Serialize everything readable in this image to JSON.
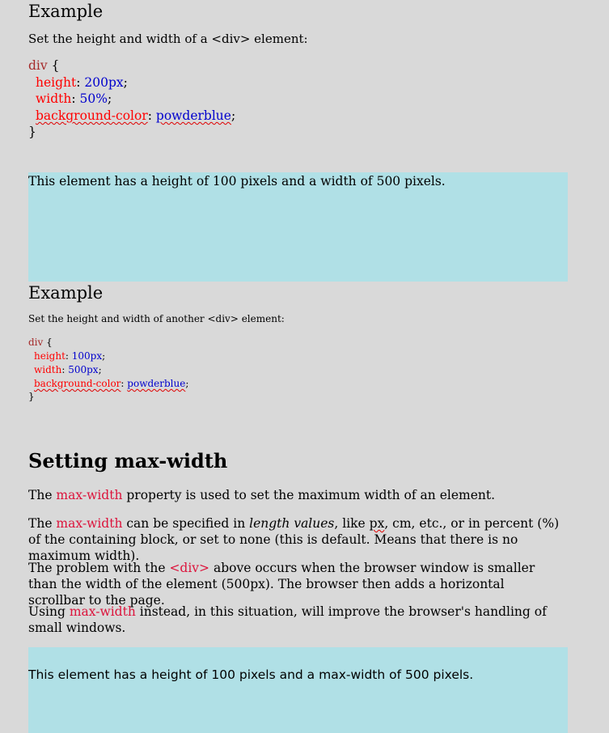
{
  "example1": {
    "heading": "Example",
    "intro": "Set the height and width of a <div> element:",
    "code": {
      "selector": "div",
      "open": " {",
      "lines": [
        {
          "prop": "height",
          "value": "200px"
        },
        {
          "prop": "width",
          "value": "50%"
        },
        {
          "prop": "background-color",
          "value": "powderblue"
        }
      ],
      "close": "}"
    }
  },
  "box1_text": "This element has a height of 100 pixels and a width of 500 pixels.",
  "example2": {
    "heading": "Example",
    "intro": "Set the height and width of another <div> element:",
    "code": {
      "selector": "div",
      "open": " {",
      "lines": [
        {
          "prop": "height",
          "value": "100px"
        },
        {
          "prop": "width",
          "value": "500px"
        },
        {
          "prop": "background-color",
          "value": "powderblue"
        }
      ],
      "close": "}"
    }
  },
  "section": {
    "heading": "Setting max-width",
    "p1": {
      "pre": "The ",
      "kw": "max-width",
      "post": " property is used to set the maximum width of an element."
    },
    "p2": {
      "pre": "The ",
      "kw": "max-width",
      "mid": " can be specified in ",
      "em": "length values",
      "mid2": ", like ",
      "px": "px",
      "post": ", cm, etc., or in percent (%) of the containing block, or set to none (this is default. Means that there is no maximum width)."
    },
    "p3": {
      "pre": "The problem with the ",
      "kw": "<div>",
      "post": " above occurs when the browser window is smaller than the width of the element (500px). The browser then adds a horizontal scrollbar to the page."
    },
    "p4": {
      "pre": "Using ",
      "kw": "max-width",
      "post": " instead, in this situation, will improve the browser's handling of small windows."
    }
  },
  "box2_text": "This element has a height of 100 pixels and a max-width of 500 pixels.",
  "colors": {
    "background": "#d9d9d9",
    "box": "#b0e0e6",
    "keyword": "#dc143c",
    "css_property": "#ff0000",
    "css_value": "#0000cd",
    "css_selector": "#a52a2a"
  }
}
